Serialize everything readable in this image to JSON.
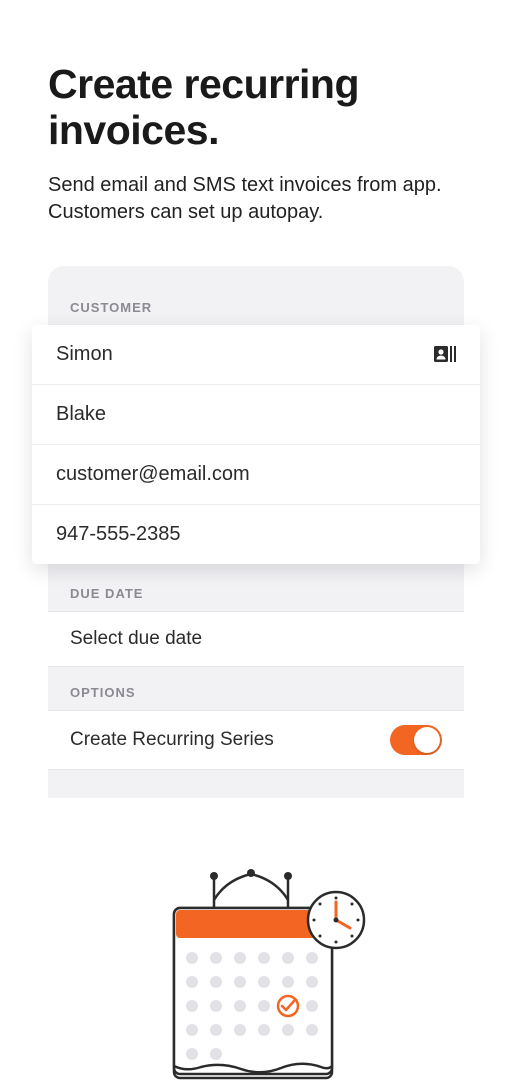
{
  "header": {
    "title": "Create recurring invoices.",
    "subtitle": "Send email and SMS text invoices from app. Customers can set up autopay."
  },
  "sections": {
    "customer_label": "CUSTOMER",
    "due_date_label": "DUE DATE",
    "options_label": "OPTIONS"
  },
  "customer": {
    "first_name": "Simon",
    "last_name": "Blake",
    "email": "customer@email.com",
    "phone": "947-555-2385"
  },
  "due_date": {
    "placeholder": "Select due date"
  },
  "options": {
    "recurring_label": "Create Recurring Series",
    "recurring_on": true
  },
  "colors": {
    "accent": "#f26522"
  }
}
